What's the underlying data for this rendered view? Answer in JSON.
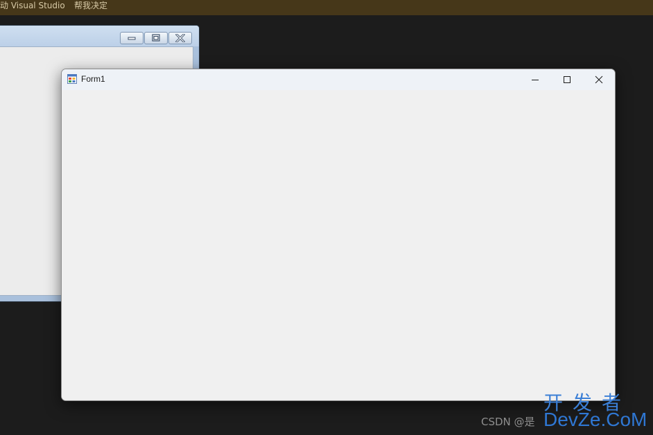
{
  "topbar": {
    "item1": "动 Visual Studio",
    "item2": "帮我决定"
  },
  "form": {
    "title": "Form1"
  },
  "watermark": {
    "csdn": "CSDN @是",
    "cn": "开发者",
    "en": "DevZe.CoM"
  },
  "colors": {
    "desktop": "#1c1c1c",
    "topbar": "#463719",
    "form_client": "#f0f0f0",
    "watermark_blue": "#3b7fd6"
  }
}
